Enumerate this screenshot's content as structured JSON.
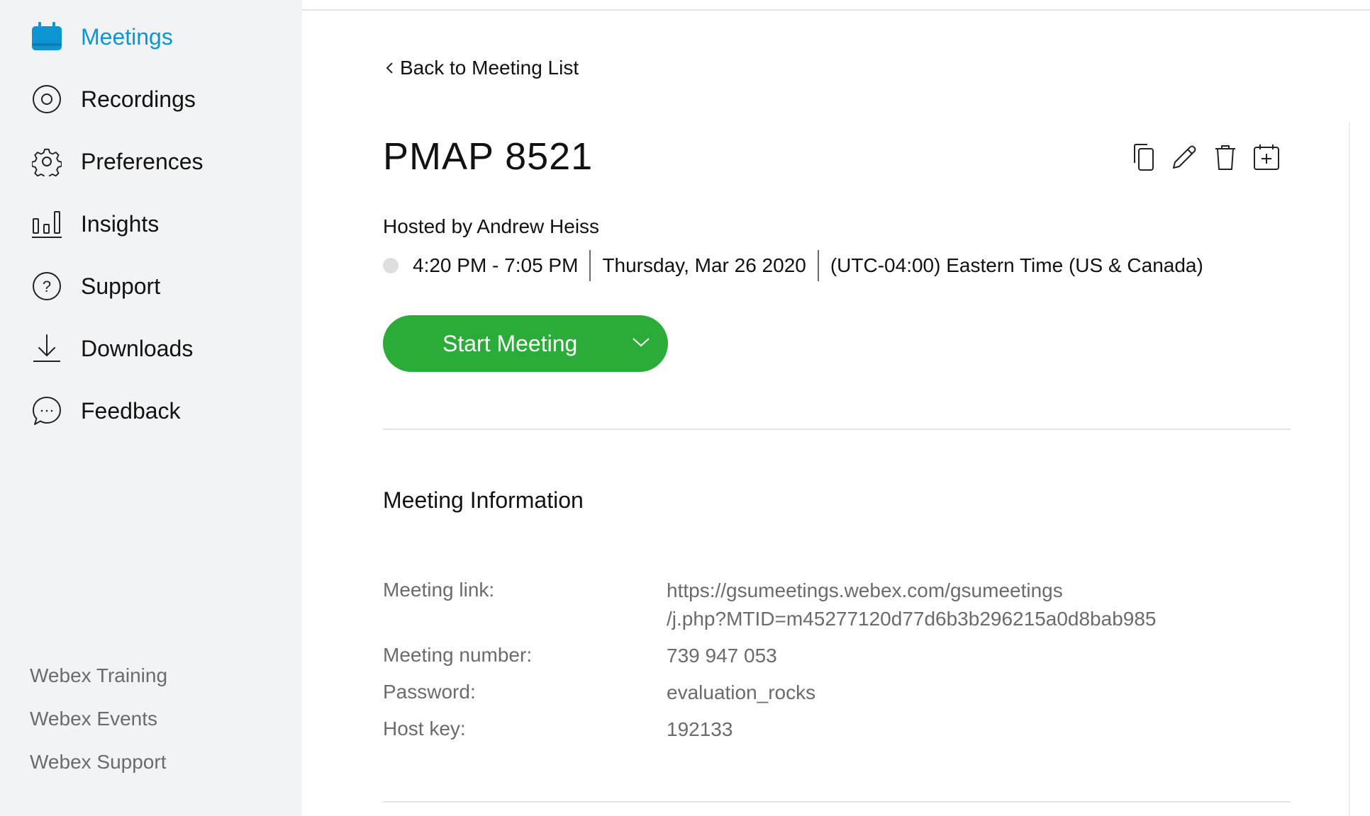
{
  "sidebar": {
    "items": [
      {
        "label": "Meetings",
        "icon": "calendar-icon",
        "active": true
      },
      {
        "label": "Recordings",
        "icon": "recording-icon",
        "active": false
      },
      {
        "label": "Preferences",
        "icon": "gear-icon",
        "active": false
      },
      {
        "label": "Insights",
        "icon": "bar-chart-icon",
        "active": false
      },
      {
        "label": "Support",
        "icon": "question-icon",
        "active": false
      },
      {
        "label": "Downloads",
        "icon": "download-icon",
        "active": false
      },
      {
        "label": "Feedback",
        "icon": "chat-bubble-icon",
        "active": false
      }
    ],
    "footer_links": [
      "Webex Training",
      "Webex Events",
      "Webex Support"
    ]
  },
  "main": {
    "back_link": "Back to Meeting List",
    "title": "PMAP 8521",
    "actions": [
      "copy-icon",
      "edit-icon",
      "delete-icon",
      "add-to-calendar-icon"
    ],
    "host": "Hosted by Andrew Heiss",
    "time": "4:20 PM - 7:05 PM",
    "date": "Thursday, Mar 26 2020",
    "timezone": "(UTC-04:00) Eastern Time (US & Canada)",
    "start_button": "Start Meeting",
    "section_title": "Meeting Information",
    "info": {
      "link_label": "Meeting link:",
      "link_line1": "https://gsumeetings.webex.com/gsumeetings",
      "link_line2": "/j.php?MTID=m45277120d77d6b3b296215a0d8bab985",
      "number_label": "Meeting number:",
      "number": "739 947 053",
      "password_label": "Password:",
      "password": "evaluation_rocks",
      "hostkey_label": "Host key:",
      "hostkey": "192133"
    }
  },
  "colors": {
    "accent": "#0b95d3",
    "start_green": "#2bab37",
    "sidebar_bg": "#f2f3f4",
    "muted_text": "#6b6b6b"
  }
}
